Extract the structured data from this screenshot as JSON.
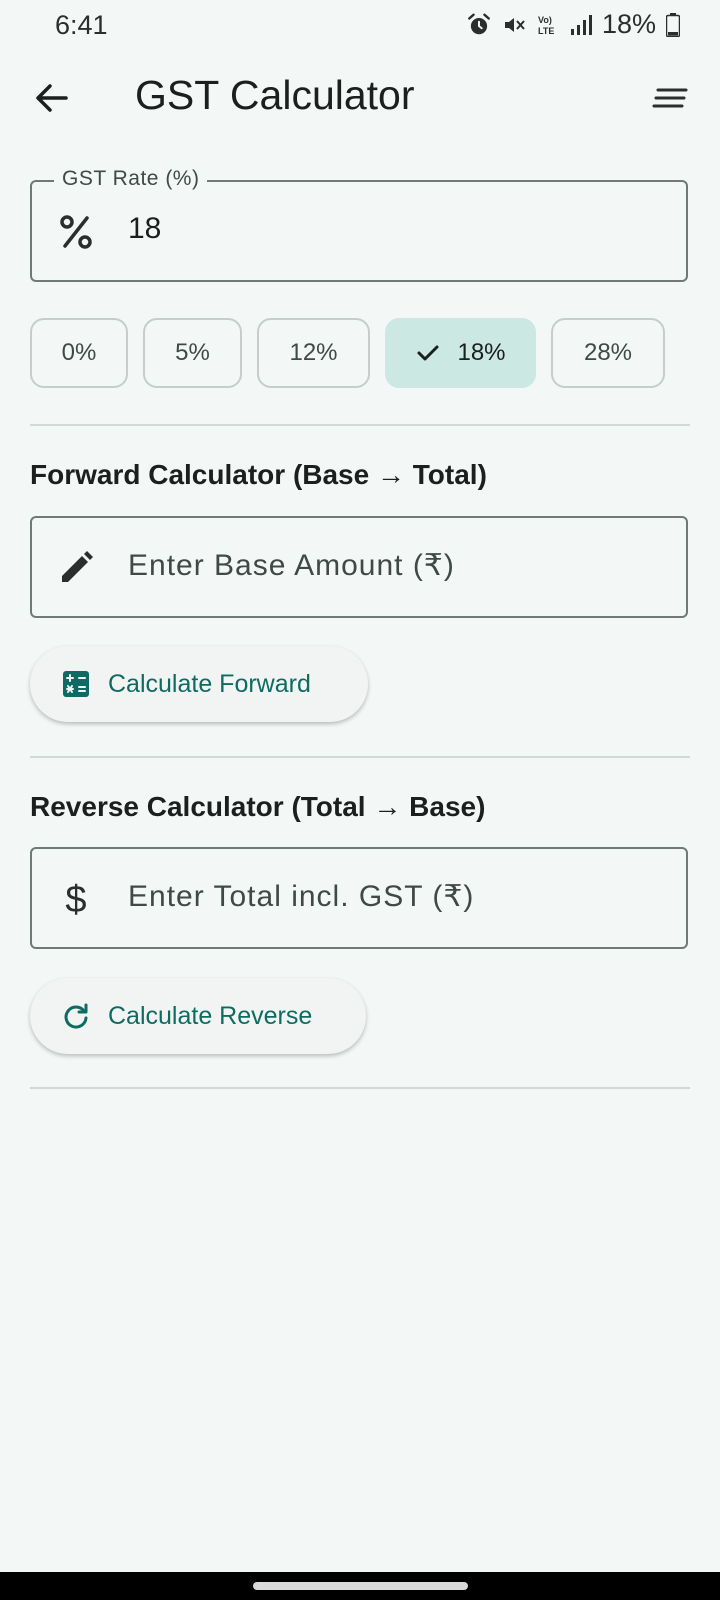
{
  "status_bar": {
    "time": "6:41",
    "battery": "18%",
    "icons": [
      "alarm-icon",
      "mute-icon",
      "volte-icon",
      "signal-icon",
      "battery-icon"
    ]
  },
  "app_bar": {
    "title": "GST Calculator",
    "back_icon": "arrow-back-icon",
    "menu_icon": "menu-icon"
  },
  "rate_field": {
    "label": "GST Rate (%)",
    "value": "18",
    "icon": "percent-icon"
  },
  "rate_chips": [
    {
      "label": "0%",
      "selected": false
    },
    {
      "label": "5%",
      "selected": false
    },
    {
      "label": "12%",
      "selected": false
    },
    {
      "label": "18%",
      "selected": true
    },
    {
      "label": "28%",
      "selected": false
    }
  ],
  "forward": {
    "title": "Forward Calculator (Base → Total)",
    "placeholder": "Enter Base Amount (₹)",
    "input_icon": "edit-pencil-icon",
    "button_label": "Calculate Forward",
    "button_icon": "calculator-icon"
  },
  "reverse": {
    "title": "Reverse Calculator (Total → Base)",
    "placeholder": "Enter Total incl. GST (₹)",
    "input_icon": "dollar-icon",
    "button_label": "Calculate Reverse",
    "button_icon": "refresh-icon"
  },
  "colors": {
    "background": "#f3f8f6",
    "accent": "#0e6b61",
    "chip_selected": "#cce8e2"
  }
}
